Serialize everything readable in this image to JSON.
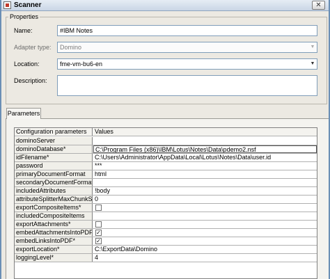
{
  "window": {
    "title": "Scanner",
    "close_glyph": "✕"
  },
  "properties": {
    "group_label": "Properties",
    "name": {
      "label": "Name:",
      "value": "#IBM Notes"
    },
    "adapter_type": {
      "label": "Adapter type:",
      "value": "Domino"
    },
    "location": {
      "label": "Location:",
      "value": "fme-vm-bu6-en"
    },
    "description": {
      "label": "Description:",
      "value": ""
    }
  },
  "parameters": {
    "tab_label": "Parameters",
    "columns": {
      "name": "Configuration parameters",
      "value": "Values"
    },
    "rows": [
      {
        "name": "dominoServer",
        "value": ""
      },
      {
        "name": "dominoDatabase*",
        "value": "C:\\Program Files (x86)\\IBM\\Lotus\\Notes\\Data\\pdemo2.nsf"
      },
      {
        "name": "idFilename*",
        "value": "C:\\Users\\Administrator\\AppData\\Local\\Lotus\\Notes\\Data\\user.id"
      },
      {
        "name": "password",
        "value": "***"
      },
      {
        "name": "primaryDocumentFormat",
        "value": "html"
      },
      {
        "name": "secondaryDocumentFormats",
        "value": ""
      },
      {
        "name": "includedAttributes",
        "value": "!body"
      },
      {
        "name": "attributeSplitterMaxChunkSizeBy",
        "value": "0"
      },
      {
        "name": "exportCompositeItems*",
        "value": "",
        "checkbox": false
      },
      {
        "name": "includedCompositeItems",
        "value": ""
      },
      {
        "name": "exportAttachments*",
        "value": "",
        "checkbox": false
      },
      {
        "name": "embedAttachmentsIntoPDF*",
        "value": "",
        "checkbox": true
      },
      {
        "name": "embedLinksIntoPDF*",
        "value": "",
        "checkbox": true
      },
      {
        "name": "exportLocation*",
        "value": "C:\\ExportData\\Domino"
      },
      {
        "name": "loggingLevel*",
        "value": "4"
      }
    ]
  },
  "icons": {
    "dropdown": "chevron-down-icon",
    "check": "✓"
  }
}
